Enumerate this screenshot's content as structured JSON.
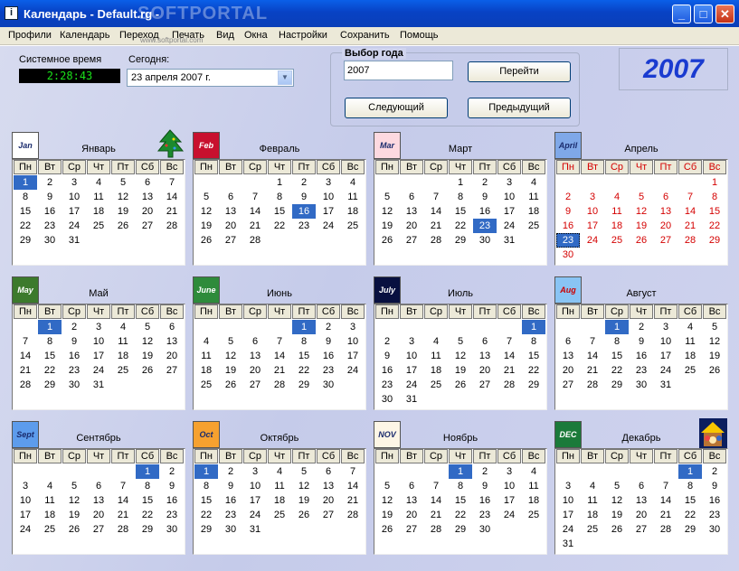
{
  "window": {
    "title": "Календарь - Default.rg -",
    "watermark": "SOFTPORTAL",
    "watermark_url": "www.softportal.com",
    "minimize_label": "_",
    "maximize_label": "□",
    "close_label": "✕"
  },
  "menu": [
    "Профили",
    "Календарь",
    "Переход",
    "Печать",
    "Вид",
    "Окна",
    "Настройки",
    "Сохранить",
    "Помощь"
  ],
  "system_time": {
    "label": "Системное время",
    "value": "2:28:43"
  },
  "today": {
    "label": "Сегодня:",
    "value": "23  апреля  2007 г."
  },
  "year_select": {
    "legend": "Выбор года",
    "value": "2007",
    "go_label": "Перейти",
    "next_label": "Следующий",
    "prev_label": "Предыдущий"
  },
  "big_year": "2007",
  "weekdays": [
    "Пн",
    "Вт",
    "Ср",
    "Чт",
    "Пт",
    "Сб",
    "Вс"
  ],
  "colors": {
    "selected": "#316ac5",
    "holiday_red": "#d40000",
    "year_blue": "#1a3bd0"
  },
  "months": [
    {
      "name": "Январь",
      "icon": "Jan",
      "icon_name": "jan-icon",
      "deco": "christmas-tree-icon",
      "start": 0,
      "days": 31,
      "sel": [
        1
      ]
    },
    {
      "name": "Февраль",
      "icon": "Feb",
      "icon_name": "feb-heart-icon",
      "start": 3,
      "days": 28,
      "sel": [
        16
      ]
    },
    {
      "name": "Март",
      "icon": "Mar",
      "icon_name": "mar-clover-icon",
      "start": 3,
      "days": 31,
      "sel": [
        23
      ]
    },
    {
      "name": "Апрель",
      "icon": "April",
      "icon_name": "april-rain-icon",
      "start": 6,
      "days": 30,
      "sel": [],
      "red": true,
      "today": 23
    },
    {
      "name": "Май",
      "icon": "May",
      "icon_name": "may-icon",
      "start": 1,
      "days": 31,
      "sel": [
        1
      ]
    },
    {
      "name": "Июнь",
      "icon": "June",
      "icon_name": "june-rose-icon",
      "start": 4,
      "days": 30,
      "sel": [
        1
      ]
    },
    {
      "name": "Июль",
      "icon": "July",
      "icon_name": "july-fireworks-icon",
      "start": 6,
      "days": 31,
      "sel": [
        1
      ]
    },
    {
      "name": "Август",
      "icon": "Aug",
      "icon_name": "aug-sun-icon",
      "start": 2,
      "days": 31,
      "sel": [
        1
      ]
    },
    {
      "name": "Сентябрь",
      "icon": "Sept",
      "icon_name": "sept-icon",
      "start": 5,
      "days": 30,
      "sel": [
        1
      ]
    },
    {
      "name": "Октябрь",
      "icon": "Oct",
      "icon_name": "oct-pumpkin-icon",
      "start": 0,
      "days": 31,
      "sel": [
        1
      ]
    },
    {
      "name": "Ноябрь",
      "icon": "NOV",
      "icon_name": "nov-turkey-icon",
      "start": 3,
      "days": 30,
      "sel": [
        1
      ]
    },
    {
      "name": "Декабрь",
      "icon": "DEC",
      "icon_name": "dec-tree-icon",
      "deco": "nativity-icon",
      "start": 5,
      "days": 31,
      "sel": [
        1
      ]
    }
  ]
}
